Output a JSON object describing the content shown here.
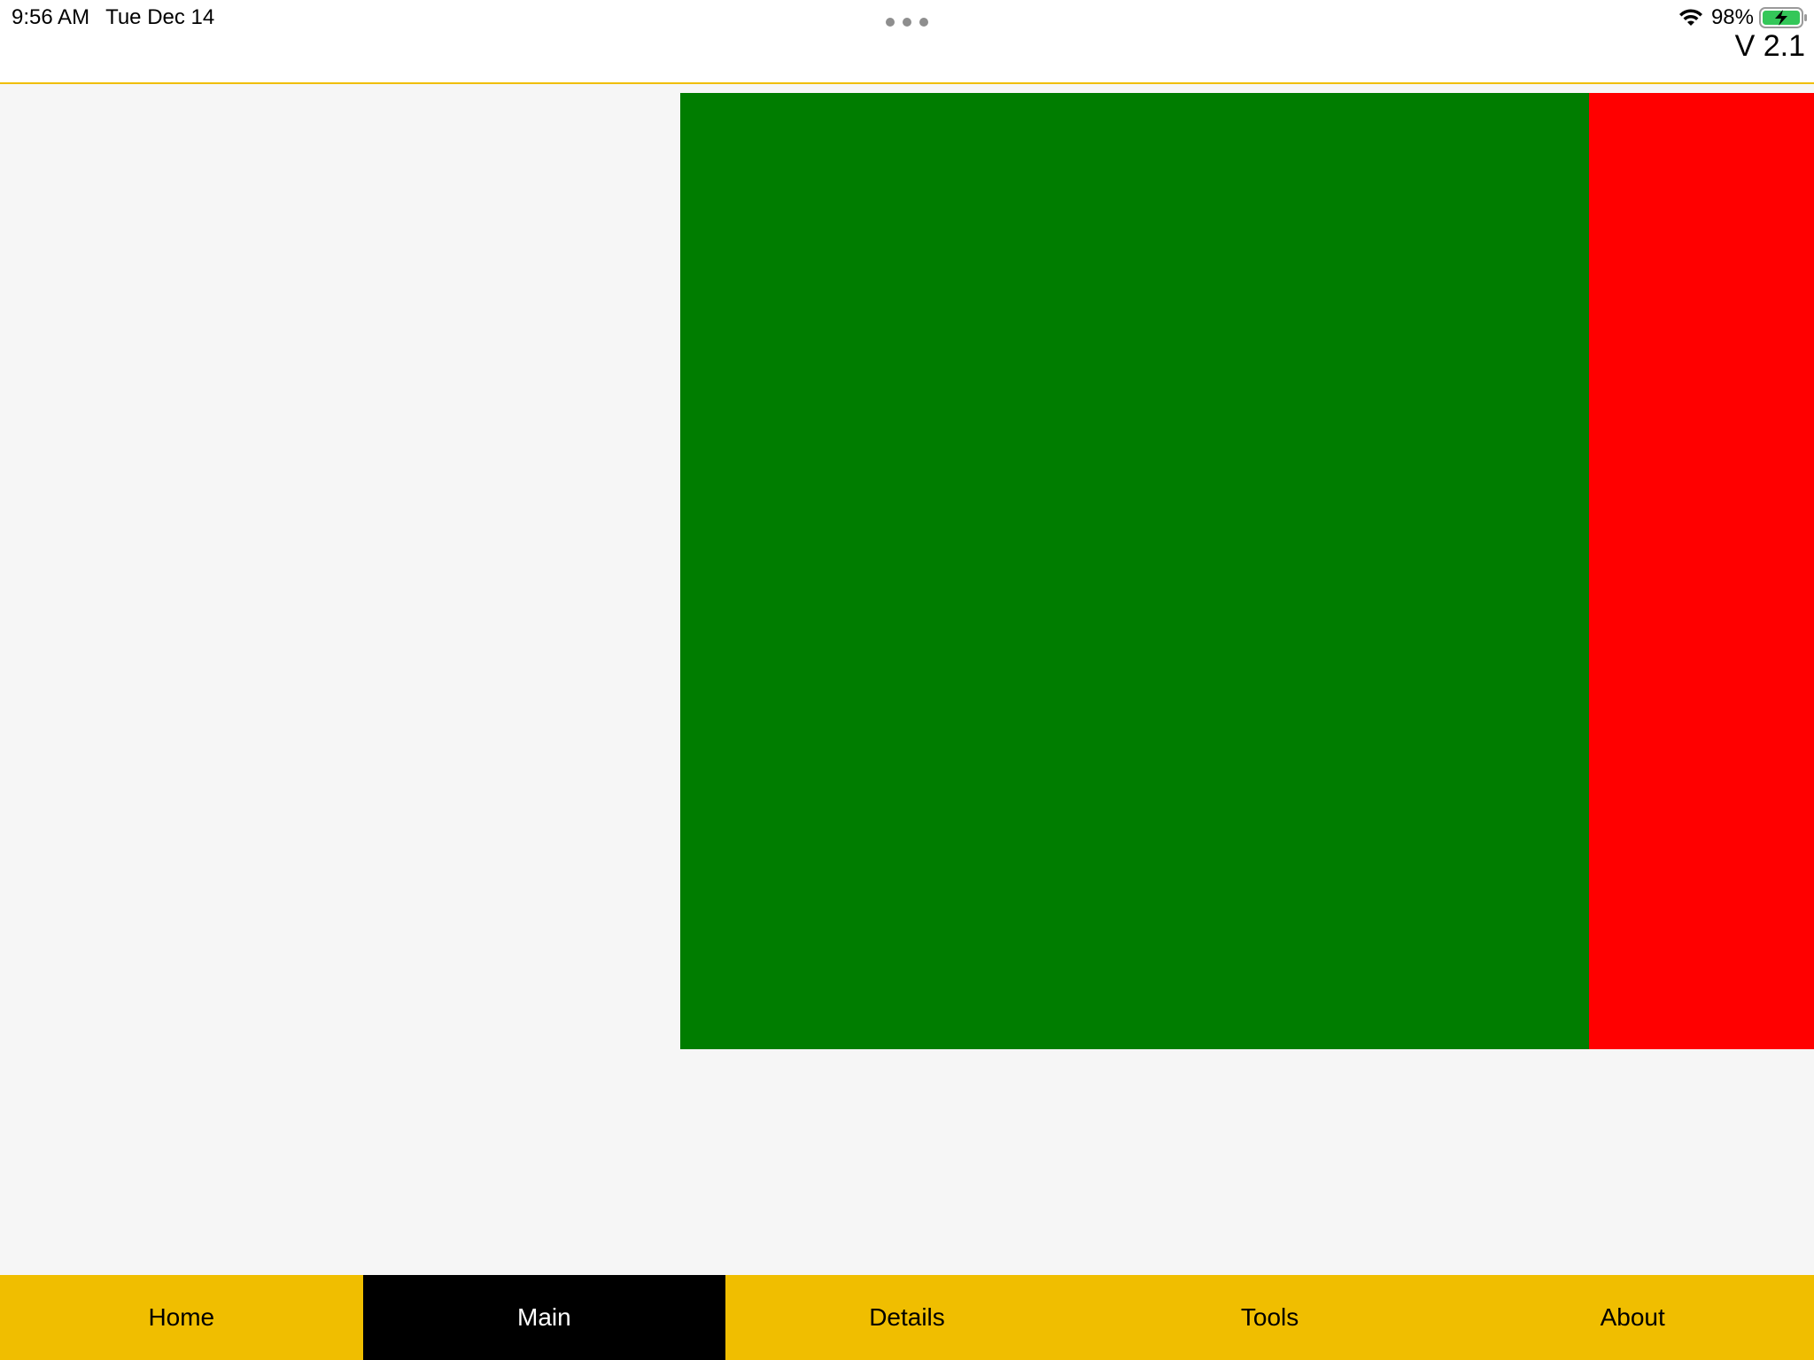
{
  "status_bar": {
    "time": "9:56 AM",
    "date": "Tue Dec 14",
    "battery_percent": "98%",
    "battery_level": 0.98,
    "wifi_icon": "wifi-icon",
    "battery_icon": "battery-charging-icon"
  },
  "header": {
    "version": "V 2.1"
  },
  "panels": {
    "left_color": "#007d00",
    "right_color": "#ff0000"
  },
  "colors": {
    "accent": "#f0be00",
    "tab_active_bg": "#000000"
  },
  "tabs": [
    {
      "label": "Home",
      "active": false
    },
    {
      "label": "Main",
      "active": true
    },
    {
      "label": "Details",
      "active": false
    },
    {
      "label": "Tools",
      "active": false
    },
    {
      "label": "About",
      "active": false
    }
  ]
}
